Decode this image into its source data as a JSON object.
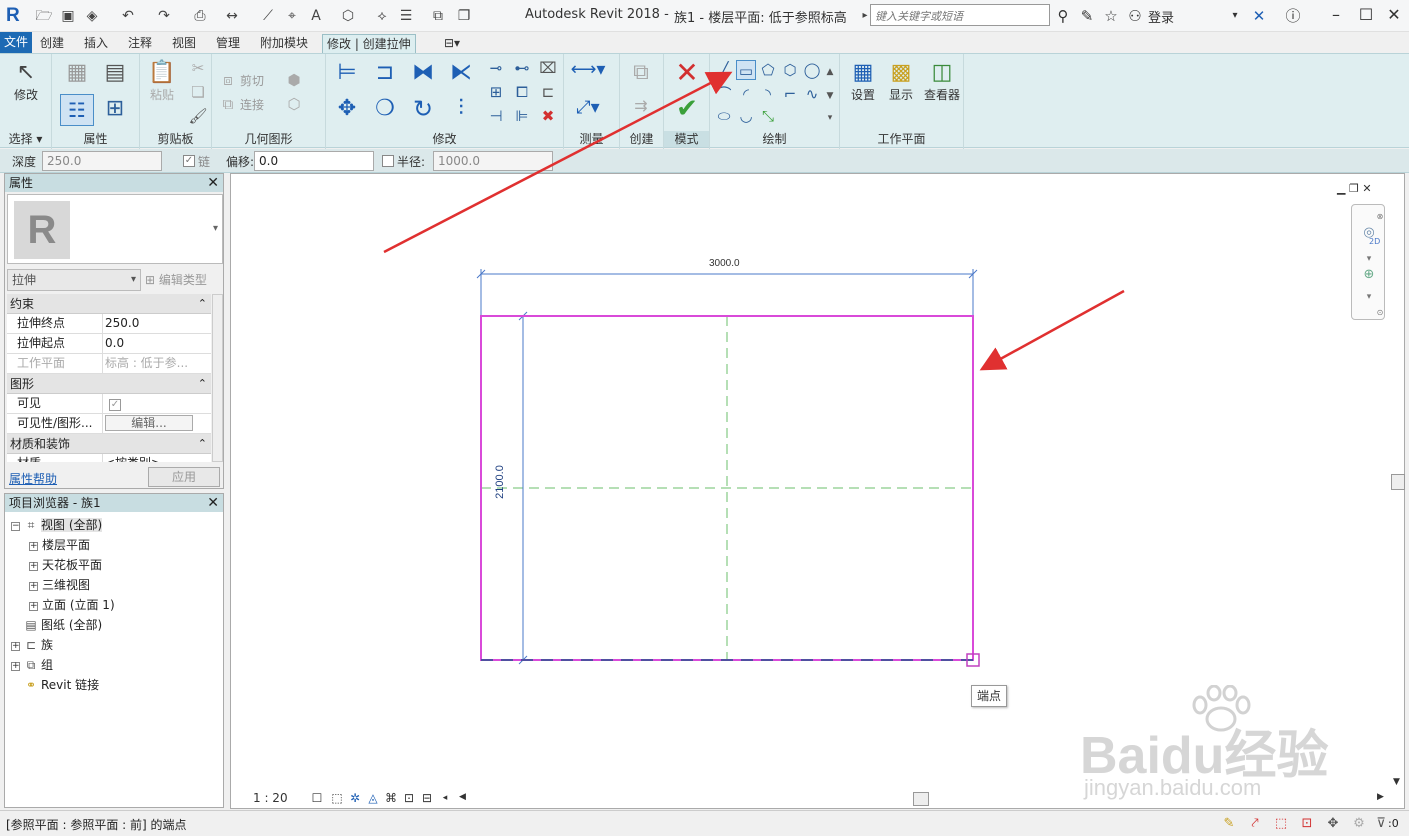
{
  "titlebar": {
    "app_title": "Autodesk Revit 2018 -",
    "doc_title": "族1 - 楼层平面: 低于参照标高",
    "search_placeholder": "键入关键字或短语",
    "login_label": "登录"
  },
  "tabs": [
    {
      "label": "文件"
    },
    {
      "label": "创建"
    },
    {
      "label": "插入"
    },
    {
      "label": "注释"
    },
    {
      "label": "视图"
    },
    {
      "label": "管理"
    },
    {
      "label": "附加模块"
    },
    {
      "label": "修改 | 创建拉伸"
    }
  ],
  "ribbon": {
    "modify_label": "修改",
    "select_label": "选择",
    "properties_label": "属性",
    "paste_label": "粘贴",
    "clipboard_label": "剪贴板",
    "cut_label": "剪切",
    "join_label": "连接",
    "geometry_label": "几何图形",
    "modify_panel_label": "修改",
    "measure_label": "测量",
    "create_label": "创建",
    "mode_label": "模式",
    "draw_label": "绘制",
    "set_label": "设置",
    "show_label": "显示",
    "viewer_label": "查看器",
    "workplane_label": "工作平面"
  },
  "optbar": {
    "depth_label": "深度",
    "depth_value": "250.0",
    "chain_label": "链",
    "offset_label": "偏移:",
    "offset_value": "0.0",
    "radius_label": "半径:",
    "radius_value": "1000.0"
  },
  "properties": {
    "title": "属性",
    "type_name": "拉伸",
    "edit_type_label": "编辑类型",
    "categories": {
      "constraints": "约束",
      "graphics": "图形",
      "materials": "材质和装饰"
    },
    "rows": {
      "extrusion_end_name": "拉伸终点",
      "extrusion_end_value": "250.0",
      "extrusion_start_name": "拉伸起点",
      "extrusion_start_value": "0.0",
      "workplane_name": "工作平面",
      "workplane_value": "标高 : 低于参...",
      "visible_name": "可见",
      "visibility_name": "可见性/图形...",
      "visibility_value": "编辑...",
      "material_name": "材质",
      "material_value": "<按类别>"
    },
    "help_label": "属性帮助",
    "apply_label": "应用"
  },
  "browser": {
    "title": "项目浏览器 - 族1",
    "items": [
      {
        "label": "视图 (全部)"
      },
      {
        "label": "楼层平面"
      },
      {
        "label": "天花板平面"
      },
      {
        "label": "三维视图"
      },
      {
        "label": "立面 (立面 1)"
      },
      {
        "label": "图纸 (全部)"
      },
      {
        "label": "族"
      },
      {
        "label": "组"
      },
      {
        "label": "Revit 链接"
      }
    ]
  },
  "canvas": {
    "dim_width": "3000.0",
    "dim_height": "2100.0",
    "tooltip": "端点",
    "scale": "1 : 20",
    "nav_2d": "2D"
  },
  "status": {
    "text": "[参照平面 : 参照平面 : 前] 的端点",
    "filter_count": ":0"
  },
  "watermark": {
    "big": "Baidu经验",
    "small": "jingyan.baidu.com"
  },
  "colors": {
    "sketch_magenta": "#d94ad9",
    "dimension_blue": "#4a78c8",
    "refplane_green": "#6bbf6b",
    "annotation_red": "#e03030",
    "ribbon_bg": "#dfeef0"
  }
}
